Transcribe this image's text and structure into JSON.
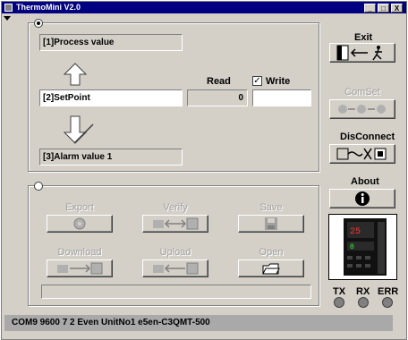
{
  "window": {
    "title": "ThermoMini V2.0",
    "minimize": "_",
    "maximize": "□",
    "close": "X"
  },
  "values": {
    "process_label": "[1]Process value",
    "setpoint_label": "[2]SetPoint",
    "alarm_label": "[3]Alarm value 1",
    "read_label": "Read",
    "write_label": "Write",
    "read_value": "0",
    "write_value": "",
    "write_checked": true,
    "check_mark": "✓"
  },
  "buttons": {
    "exit": "Exit",
    "comset": "ComSet",
    "disconnect": "DisConnect",
    "about": "About",
    "export": "Export",
    "verify": "Verify",
    "save": "Save",
    "download": "Download",
    "upload": "Upload",
    "open": "Open"
  },
  "leds": {
    "tx": "TX",
    "rx": "RX",
    "err": "ERR"
  },
  "status": "COM9 9600 7 2 Even UnitNo1  e5en-C3QMT-500",
  "colors": {
    "titlebar": "#000080",
    "face": "#d4d0c8",
    "status_bar": "#a9a9a9"
  }
}
